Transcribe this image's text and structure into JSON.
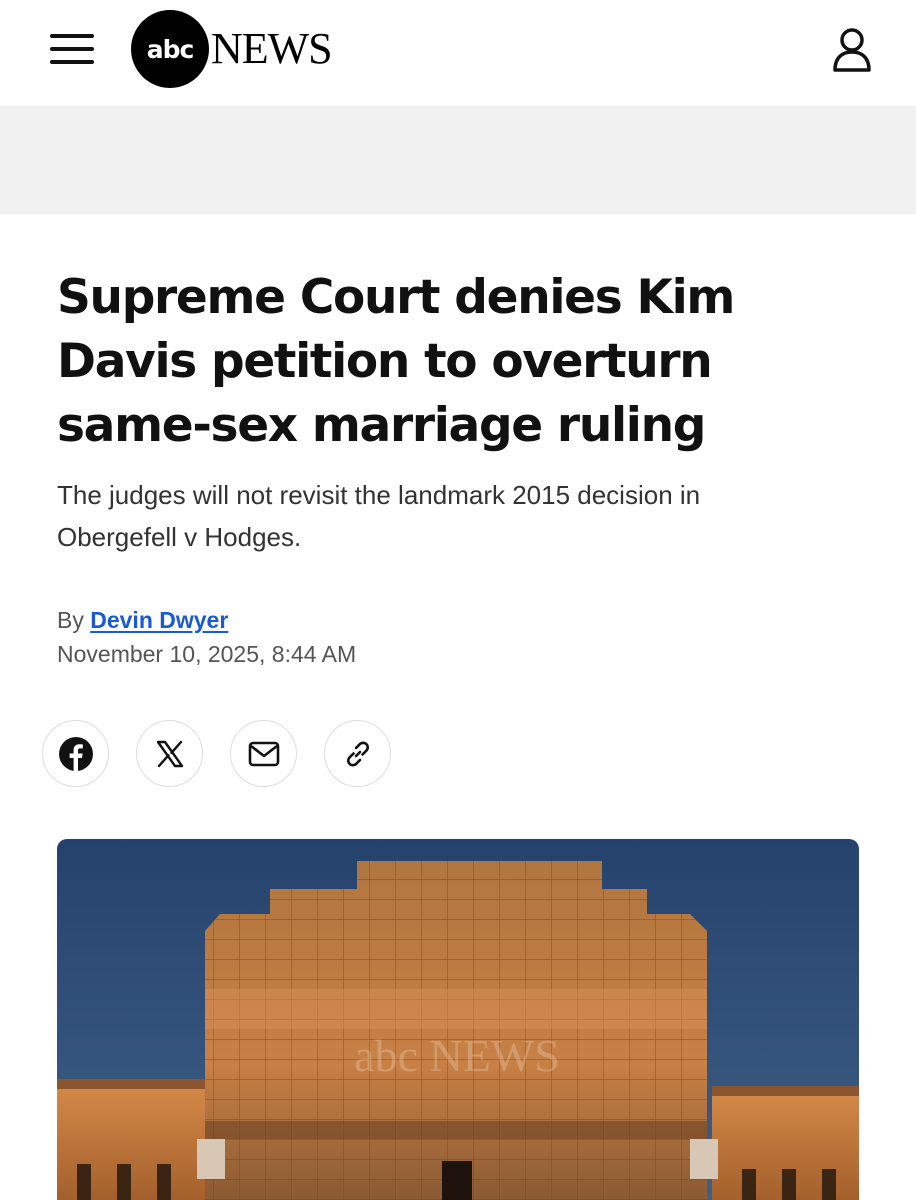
{
  "header": {
    "logo_circle_text": "abc",
    "logo_word": "NEWS",
    "icons": {
      "menu": "hamburger-menu-icon",
      "account": "user-account-icon"
    }
  },
  "article": {
    "headline": "Supreme Court denies Kim Davis petition to overturn same-sex marriage ruling",
    "dek": "The judges will not revisit the landmark 2015 decision in Obergefell v Hodges.",
    "byline_prefix": "By",
    "author": "Devin Dwyer",
    "timestamp": "November 10, 2025, 8:44 AM"
  },
  "share": {
    "items": [
      {
        "icon": "facebook-icon"
      },
      {
        "icon": "x-icon"
      },
      {
        "icon": "mail-icon"
      },
      {
        "icon": "link-icon"
      }
    ]
  },
  "hero": {
    "watermark_text": "abc NEWS"
  },
  "colors": {
    "link": "#1a5ad6",
    "ad_band": "#f1f1f2",
    "sky": "#2f4a72",
    "building": "#c9773a"
  }
}
